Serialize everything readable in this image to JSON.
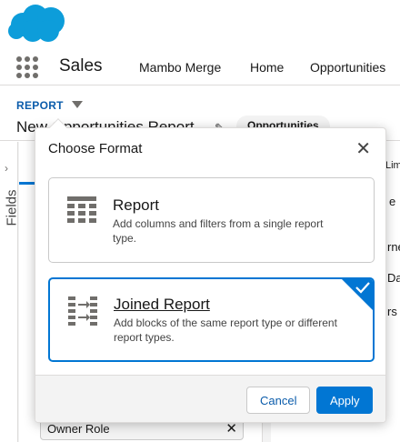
{
  "header": {
    "logo": "salesforce-cloud-icon"
  },
  "nav": {
    "app_name": "Sales",
    "items": [
      "Mambo Merge",
      "Home",
      "Opportunities"
    ]
  },
  "report_bar": {
    "label": "REPORT",
    "title": "New Opportunities Report",
    "object_pill": "Opportunities"
  },
  "side_rail": {
    "label": "Fields"
  },
  "filters": {
    "owner_role": "Owner Role"
  },
  "right_panel": {
    "lines": [
      "Limit",
      "e",
      "rne",
      "Dat",
      "rs i"
    ]
  },
  "modal": {
    "title": "Choose Format",
    "options": [
      {
        "title": "Report",
        "description": "Add columns and filters from a single report type.",
        "icon": "table-grid-icon",
        "selected": false
      },
      {
        "title": "Joined Report",
        "description": "Add blocks of the same report type or different report types.",
        "icon": "joined-report-icon",
        "selected": true
      }
    ],
    "cancel_label": "Cancel",
    "apply_label": "Apply"
  },
  "colors": {
    "brand": "#0176d3",
    "link": "#0b5cab",
    "text": "#181818"
  }
}
